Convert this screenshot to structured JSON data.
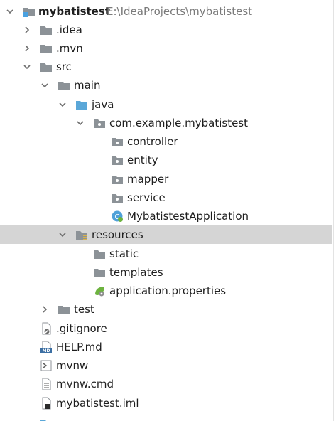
{
  "project": {
    "name": "mybatistest",
    "path": "E:\\IdeaProjects\\mybatistest"
  },
  "tree": {
    "idea": ".idea",
    "mvn": ".mvn",
    "src": "src",
    "main": "main",
    "java": "java",
    "package": "com.example.mybatistest",
    "controller": "controller",
    "entity": "entity",
    "mapper": "mapper",
    "service": "service",
    "app_class": "MybatistestApplication",
    "resources": "resources",
    "static": "static",
    "templates": "templates",
    "app_properties": "application.properties",
    "test": "test",
    "gitignore": ".gitignore",
    "help": "HELP.md",
    "mvnw": "mvnw",
    "mvnw_cmd": "mvnw.cmd",
    "iml": "mybatistest.iml"
  },
  "icons": {
    "folder": "folder-icon",
    "source_root": "source-folder-icon",
    "resources_root": "resources-folder-icon",
    "class": "spring-class-icon",
    "properties": "spring-properties-icon",
    "file": "file-icon"
  },
  "colors": {
    "folder": "#8c9297",
    "source_folder": "#5aa7d8",
    "resources_badge": "#d9b24a",
    "selected_row": "#d5d5d5",
    "path_text": "#7a7a7a"
  }
}
